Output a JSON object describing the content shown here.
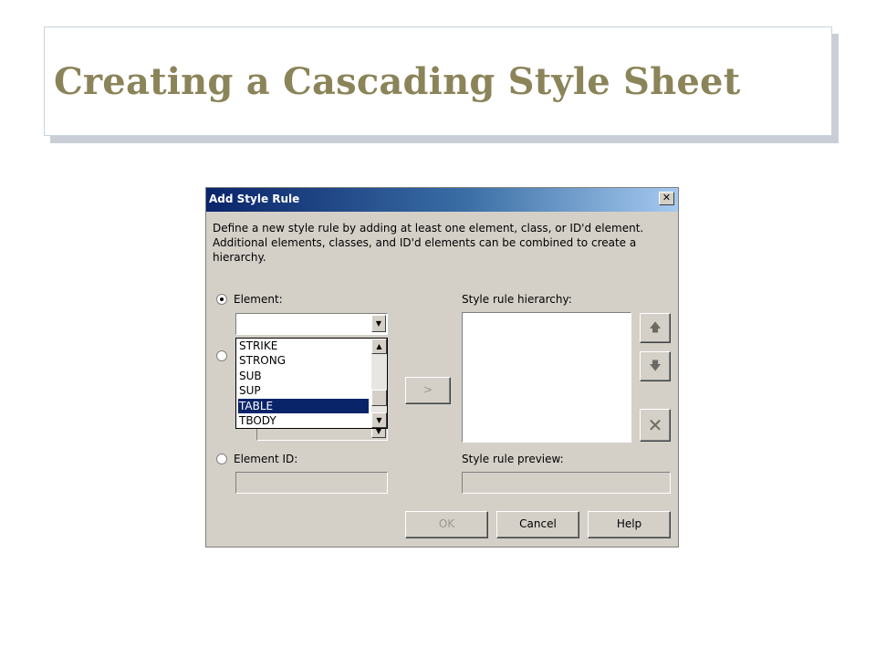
{
  "slide": {
    "title": "Creating a Cascading Style Sheet"
  },
  "dialog": {
    "title": "Add Style Rule",
    "close_glyph": "✕",
    "description": "Define a new style rule by adding at least one element, class, or ID'd element. Additional elements, classes, and ID'd elements can be combined to create a hierarchy.",
    "element_label": "Element:",
    "element_value": "",
    "element_id_label": "Element ID:",
    "element_id_value": "",
    "hierarchy_label": "Style rule hierarchy:",
    "preview_label": "Style rule preview:",
    "preview_value": "",
    "add_button": ">",
    "move_up_glyph": "🡅",
    "move_down_glyph": "🡇",
    "delete_glyph": "✕",
    "ok_label": "OK",
    "cancel_label": "Cancel",
    "help_label": "Help",
    "dropdown": {
      "items": [
        "STRIKE",
        "STRONG",
        "SUB",
        "SUP",
        "TABLE",
        "TBODY"
      ],
      "selected": "TABLE"
    },
    "radio": {
      "element_checked": true,
      "class_checked": false,
      "element_id_checked": false
    }
  }
}
